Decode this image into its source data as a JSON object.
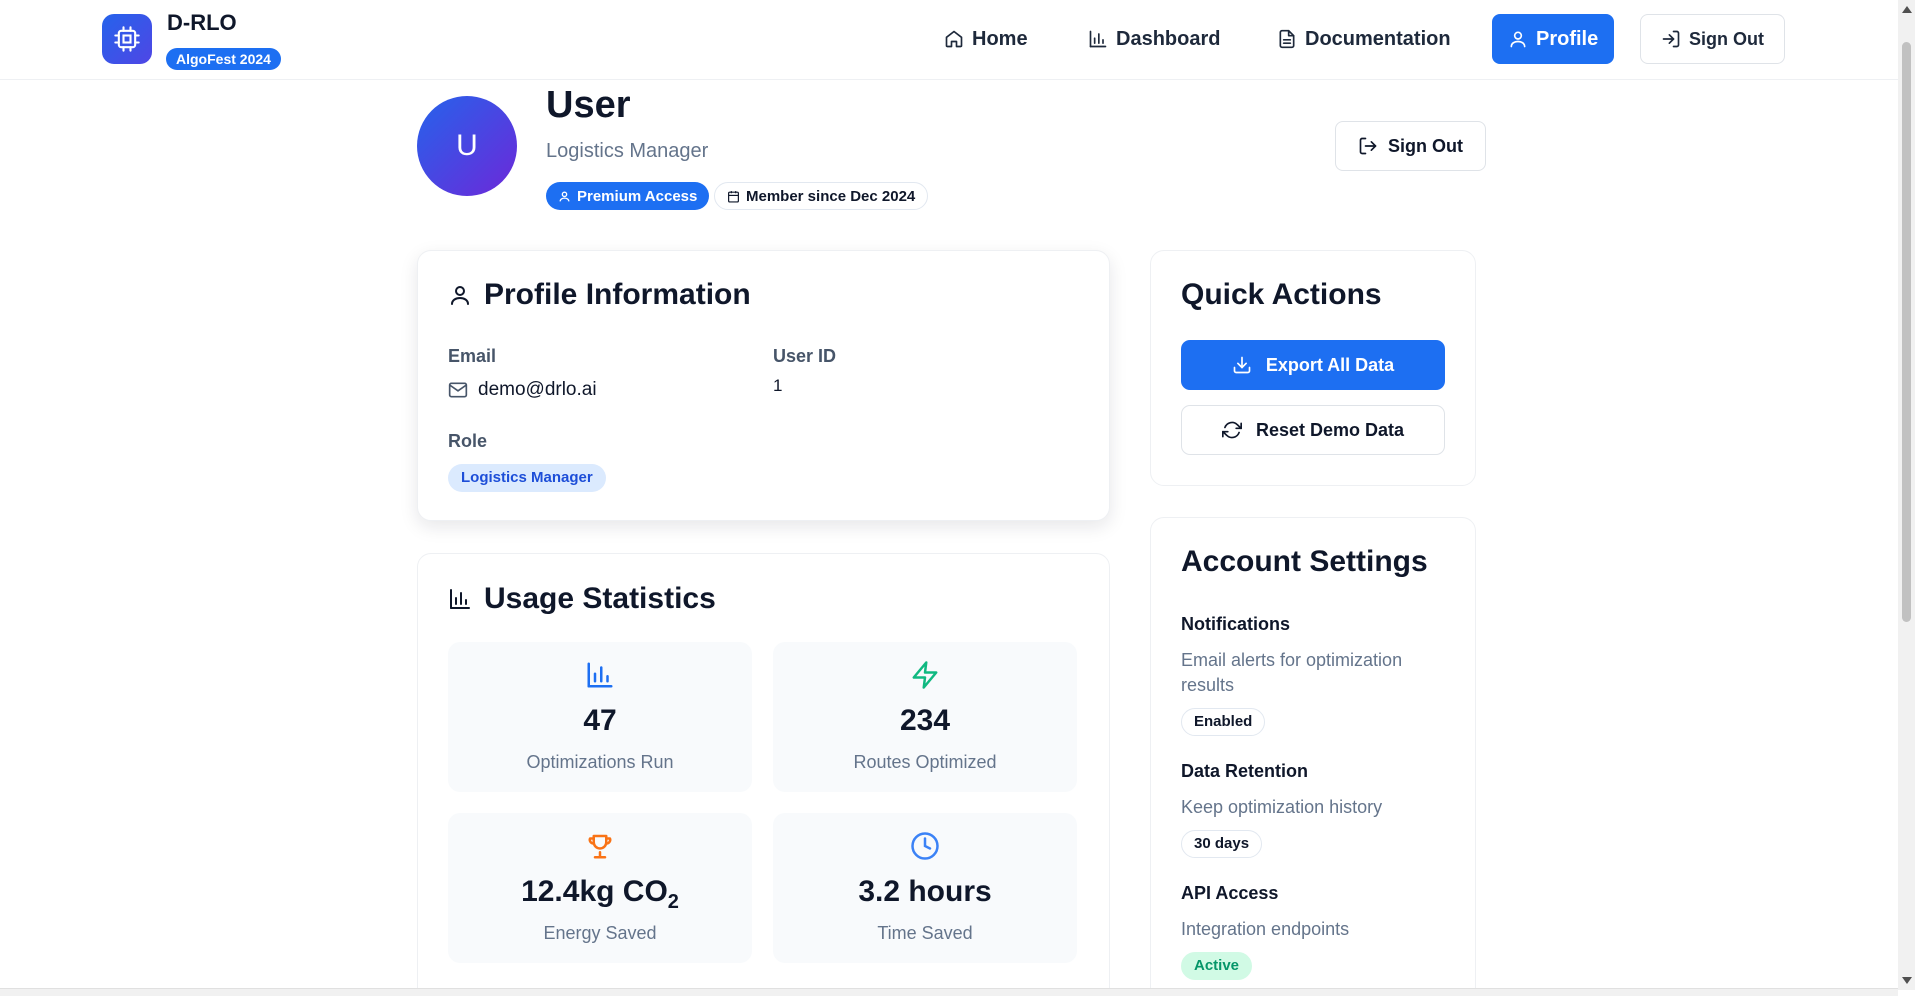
{
  "brand": {
    "title": "D-RLO",
    "badge": "AlgoFest 2024"
  },
  "nav": {
    "home": "Home",
    "dashboard": "Dashboard",
    "documentation": "Documentation",
    "profile": "Profile",
    "sign_out": "Sign Out"
  },
  "profile": {
    "avatar_initial": "U",
    "name": "User",
    "role": "Logistics Manager",
    "premium_label": "Premium Access",
    "member_since": "Member since Dec 2024",
    "sign_out": "Sign Out"
  },
  "profile_info": {
    "title": "Profile Information",
    "email_label": "Email",
    "email_value": "demo@drlo.ai",
    "user_id_label": "User ID",
    "user_id_value": "1",
    "role_label": "Role",
    "role_value": "Logistics Manager"
  },
  "usage": {
    "title": "Usage Statistics",
    "stats": [
      {
        "value": "47",
        "label": "Optimizations Run",
        "icon": "bar-chart-icon",
        "color": "#1d6ff2"
      },
      {
        "value": "234",
        "label": "Routes Optimized",
        "icon": "zap-icon",
        "color": "#10b981"
      },
      {
        "value_main": "12.4kg CO",
        "value_sub": "2",
        "label": "Energy Saved",
        "icon": "trophy-icon",
        "color": "#f97316"
      },
      {
        "value": "3.2 hours",
        "label": "Time Saved",
        "icon": "clock-icon",
        "color": "#3b82f6"
      }
    ]
  },
  "quick_actions": {
    "title": "Quick Actions",
    "export": "Export All Data",
    "reset": "Reset Demo Data"
  },
  "account_settings": {
    "title": "Account Settings",
    "notifications": {
      "head": "Notifications",
      "desc": "Email alerts for optimization results",
      "pill": "Enabled"
    },
    "retention": {
      "head": "Data Retention",
      "desc": "Keep optimization history",
      "pill": "30 days"
    },
    "api": {
      "head": "API Access",
      "desc": "Integration endpoints",
      "pill": "Active"
    }
  },
  "colors": {
    "primary": "#1d6ff2",
    "success": "#059669",
    "accent_orange": "#f97316"
  }
}
